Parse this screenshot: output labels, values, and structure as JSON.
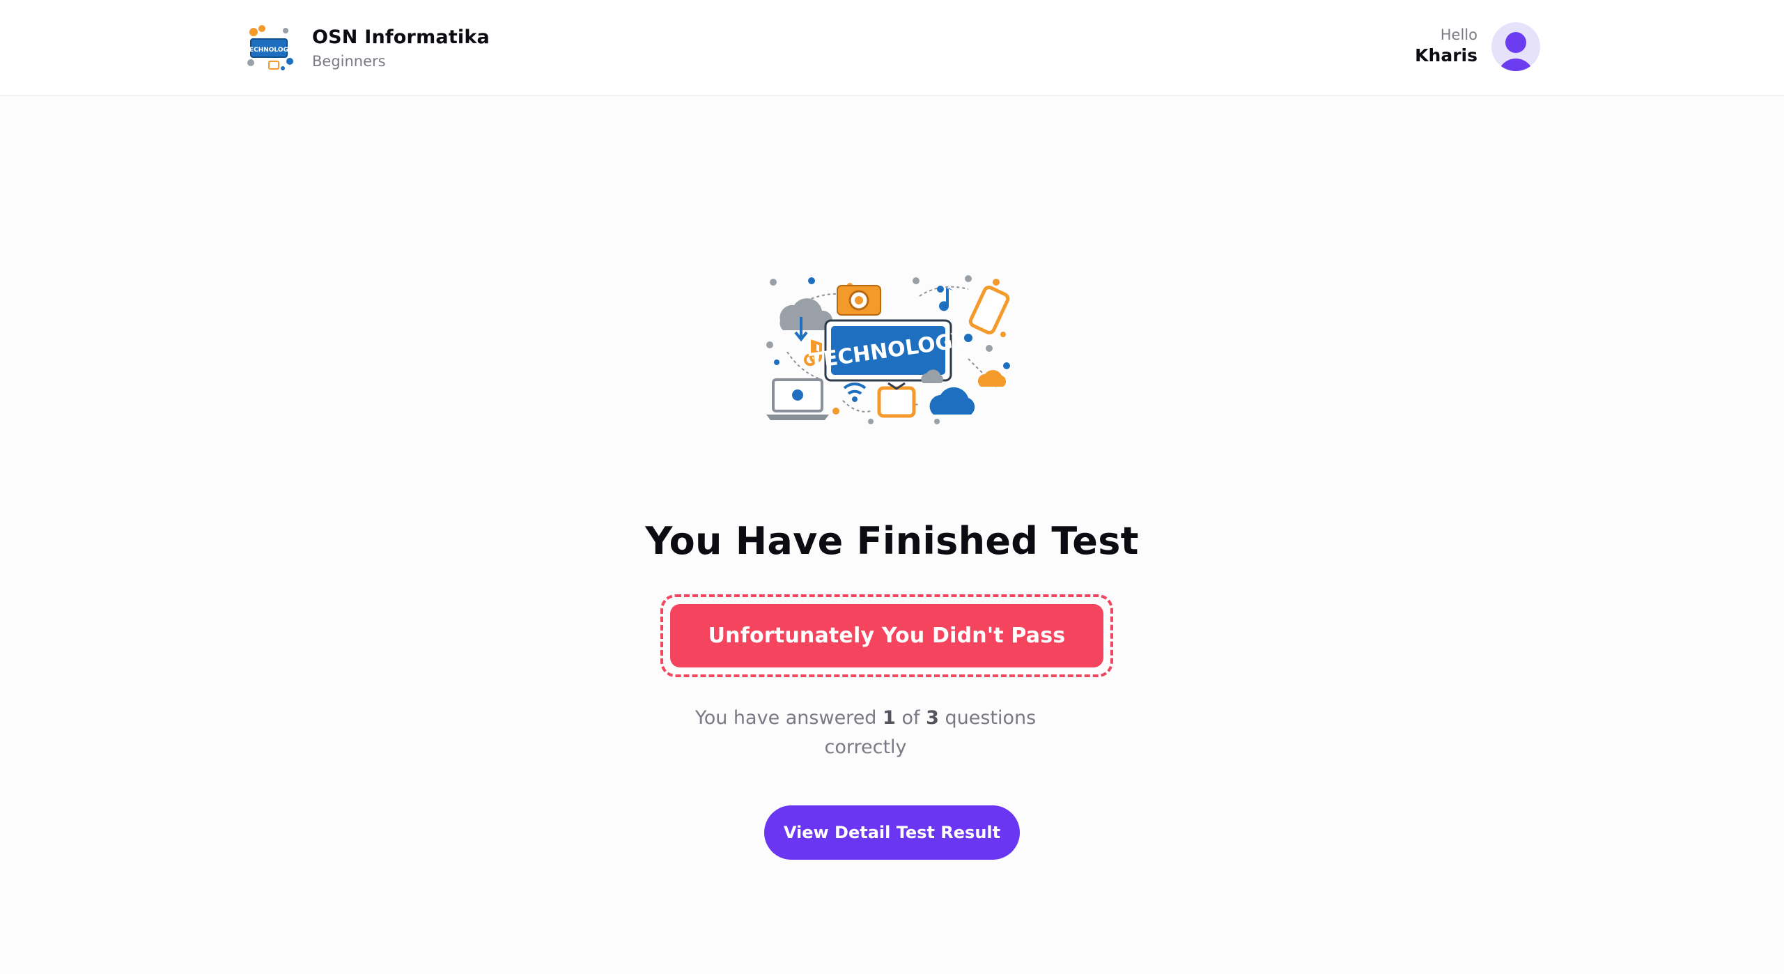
{
  "header": {
    "app_title": "OSN Informatika",
    "app_subtitle": "Beginners",
    "logo_label": "TECHNOLOGY",
    "greeting": "Hello",
    "user_name": "Kharis"
  },
  "main": {
    "illustration_label": "TECHNOLOGY",
    "title": "You Have Finished Test",
    "result_label": "Unfortunately You Didn't Pass",
    "summary": {
      "prefix": "You have answered",
      "correct": "1",
      "of": "of",
      "total": "3",
      "suffix": "questions correctly"
    },
    "detail_button_label": "View Detail Test Result"
  },
  "colors": {
    "accent": "#6a36f2",
    "fail": "#f5445d",
    "illustration_blue": "#1f6fc0",
    "illustration_orange": "#f39a2b"
  },
  "icons": {
    "logo": "technology-logo-icon",
    "avatar": "user-avatar-icon",
    "illustration": "technology-illustration"
  }
}
